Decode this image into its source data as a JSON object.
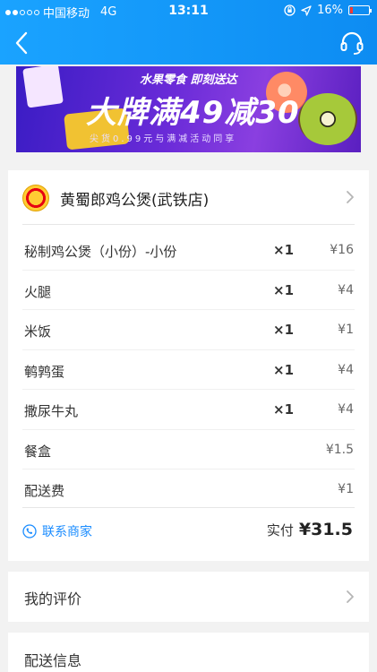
{
  "status": {
    "carrier": "中国移动",
    "network": "4G",
    "time": "13:11",
    "battery": "16%",
    "battery_level": 0.16,
    "signal_bars_on": 2,
    "signal_bars_total": 5
  },
  "banner": {
    "subtitle": "水果零食 即刻送达",
    "title": "大牌满49减30",
    "footnote": "尖货0.99元与满减活动同享"
  },
  "shop": {
    "name": "黄蜀郎鸡公煲(武铁店)"
  },
  "items": [
    {
      "name": "秘制鸡公煲（小份）-小份",
      "qty": "×1",
      "price": "¥16"
    },
    {
      "name": "火腿",
      "qty": "×1",
      "price": "¥4"
    },
    {
      "name": "米饭",
      "qty": "×1",
      "price": "¥1"
    },
    {
      "name": "鹌鹑蛋",
      "qty": "×1",
      "price": "¥4"
    },
    {
      "name": "撒尿牛丸",
      "qty": "×1",
      "price": "¥4"
    },
    {
      "name": "餐盒",
      "qty": "",
      "price": "¥1.5"
    },
    {
      "name": "配送费",
      "qty": "",
      "price": "¥1"
    }
  ],
  "footer": {
    "contact_label": "联系商家",
    "paid_label": "实付",
    "paid_amount": "¥31.5"
  },
  "review": {
    "title": "我的评价"
  },
  "delivery": {
    "title": "配送信息"
  },
  "colors": {
    "nav_bar": "#1aa3ff",
    "link": "#1a8cff",
    "battery_low": "#ff3b30"
  },
  "icons": {
    "back": "chevron-left-icon",
    "service": "headset-icon",
    "phone": "phone-icon",
    "arrow": "chevron-right-icon"
  }
}
